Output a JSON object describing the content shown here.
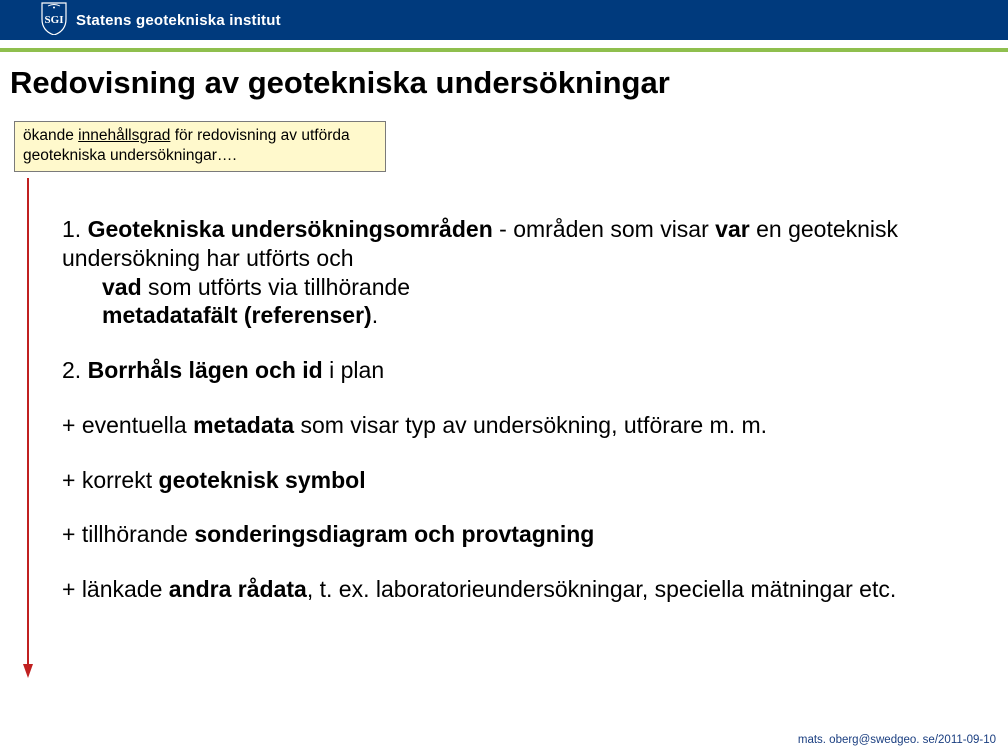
{
  "header": {
    "org_name": "Statens geotekniska institut",
    "logo_abbrev": "SGI"
  },
  "title": {
    "bold": "Redovisning",
    "rest": " av geotekniska undersökningar"
  },
  "callout": {
    "pre": "ökande ",
    "underlined": "innehållsgrad",
    "post": " för redovisning av utförda geotekniska undersökningar…."
  },
  "items": {
    "i1": {
      "num": "1. ",
      "b1": "Geotekniska undersökningsområden",
      "t1": " - områden som visar ",
      "b2": "var",
      "t2": " en geoteknisk undersökning har utförts och ",
      "b3": "vad",
      "t3": " som utförts via tillhörande ",
      "b4": "metadatafält (referenser)",
      "t4": "."
    },
    "i2": {
      "num": "2. ",
      "b1": "Borrhåls lägen och id",
      "t1": " i plan"
    },
    "i3": {
      "t1": "+ eventuella ",
      "b1": "metadata",
      "t2": " som visar typ av undersökning, utförare m. m."
    },
    "i4": {
      "t1": "+ korrekt ",
      "b1": "geoteknisk symbol"
    },
    "i5": {
      "t1": "+ tillhörande ",
      "b1": "sonderingsdiagram och provtagning"
    },
    "i6": {
      "t1": "+ länkade ",
      "b1": "andra rådata",
      "t2": ", t. ex. laboratorieundersökningar, speciella mätningar etc."
    }
  },
  "footer": "mats. oberg@swedgeo. se/2011-09-10"
}
